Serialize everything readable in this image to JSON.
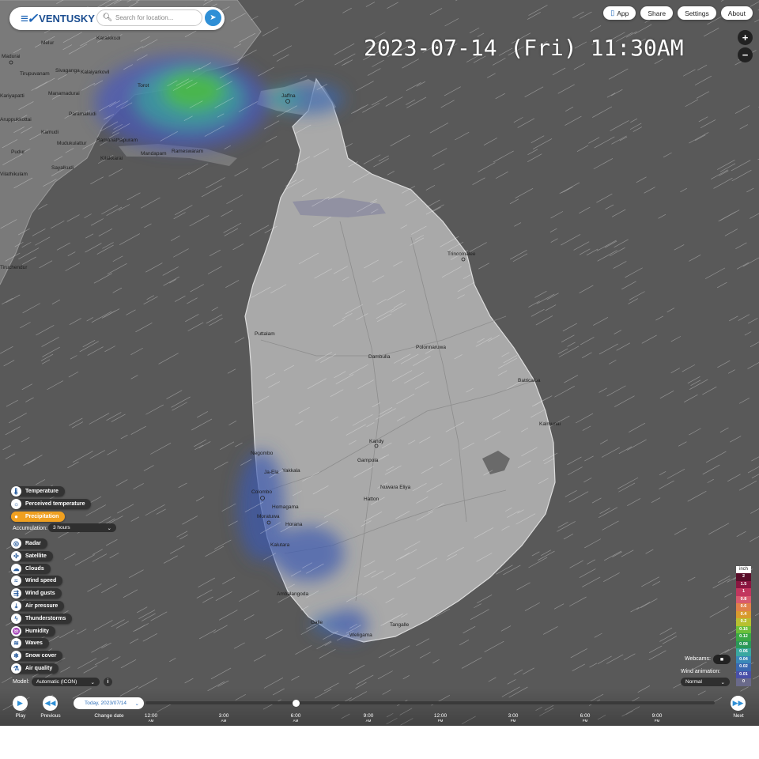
{
  "header": {
    "logo_text": "VENTUSKY",
    "search_placeholder": "Search for location...",
    "buttons": {
      "app": "App",
      "share": "Share",
      "settings": "Settings",
      "about": "About"
    }
  },
  "timestamp": "2023-07-14 (Fri) 11:30AM",
  "zoom": {
    "in": "+",
    "out": "−"
  },
  "map_labels": [
    "Madurai",
    "Melur",
    "Karaikkudi",
    "Tirupuvanam",
    "Sivaganga",
    "Kalaiyarkovil",
    "Torot",
    "Kariyapatti",
    "Manamadurai",
    "Aruppukkottai",
    "Paramakudi",
    "Kamudi",
    "Mudukulattur",
    "Ramanathapuram",
    "Pudur",
    "Kilakkarai",
    "Mandapam",
    "Rameswaram",
    "Sayalkudi",
    "Vilathikulam",
    "Tiruchendur",
    "Jaffna",
    "Trincomalee",
    "Puttalam",
    "Polonnaruwa",
    "Dambulla",
    "Batticaloa",
    "Kalmunai",
    "Kandy",
    "Gampola",
    "Negombo",
    "Ja-Ela",
    "Yakkala",
    "Nuwara Eliya",
    "Colombo",
    "Homagama",
    "Hatton",
    "Moratuwa",
    "Horana",
    "Kalutara",
    "Ambalangoda",
    "Galle",
    "Weligama",
    "Tangalle"
  ],
  "layers": {
    "temperature": "Temperature",
    "perceived": "Perceived temperature",
    "precipitation": "Precipitation",
    "accumulation_label": "Accumulation:",
    "accumulation_value": "3 hours",
    "radar": "Radar",
    "satellite": "Satellite",
    "clouds": "Clouds",
    "wind_speed": "Wind speed",
    "wind_gusts": "Wind gusts",
    "air_pressure": "Air pressure",
    "thunderstorms": "Thunderstorms",
    "humidity": "Humidity",
    "waves": "Waves",
    "snow_cover": "Snow cover",
    "air_quality": "Air quality",
    "model_label": "Model:",
    "model_value": "Automatic (ICON)",
    "info": "i"
  },
  "legend": {
    "unit": "inch",
    "values": [
      "2",
      "1.5",
      "1",
      "0.8",
      "0.6",
      "0.4",
      "0.2",
      "0.16",
      "0.12",
      "0.08",
      "0.06",
      "0.04",
      "0.02",
      "0.01",
      "0"
    ],
    "colors": [
      "#5a0e2a",
      "#8a1640",
      "#c2365e",
      "#d85a6e",
      "#e0804a",
      "#d89a2e",
      "#b8c030",
      "#6cbf3a",
      "#3aa845",
      "#2a9858",
      "#3aa8a0",
      "#3a88b8",
      "#3a68b0",
      "#4a50a8",
      "#6a6a8a"
    ]
  },
  "webcams_label": "Webcams:",
  "wind_animation": {
    "label": "Wind animation:",
    "value": "Normal"
  },
  "timeline": {
    "play": "Play",
    "previous": "Previous",
    "next": "Next",
    "change_date": "Change date",
    "date_value": "Today, 2023/07/14",
    "ticks": [
      {
        "time": "12:00",
        "ampm": "AM"
      },
      {
        "time": "3:00",
        "ampm": "AM"
      },
      {
        "time": "6:00",
        "ampm": "AM"
      },
      {
        "time": "9:00",
        "ampm": "AM"
      },
      {
        "time": "12:00",
        "ampm": "PM"
      },
      {
        "time": "3:00",
        "ampm": "PM"
      },
      {
        "time": "6:00",
        "ampm": "PM"
      },
      {
        "time": "9:00",
        "ampm": "PM"
      }
    ]
  }
}
